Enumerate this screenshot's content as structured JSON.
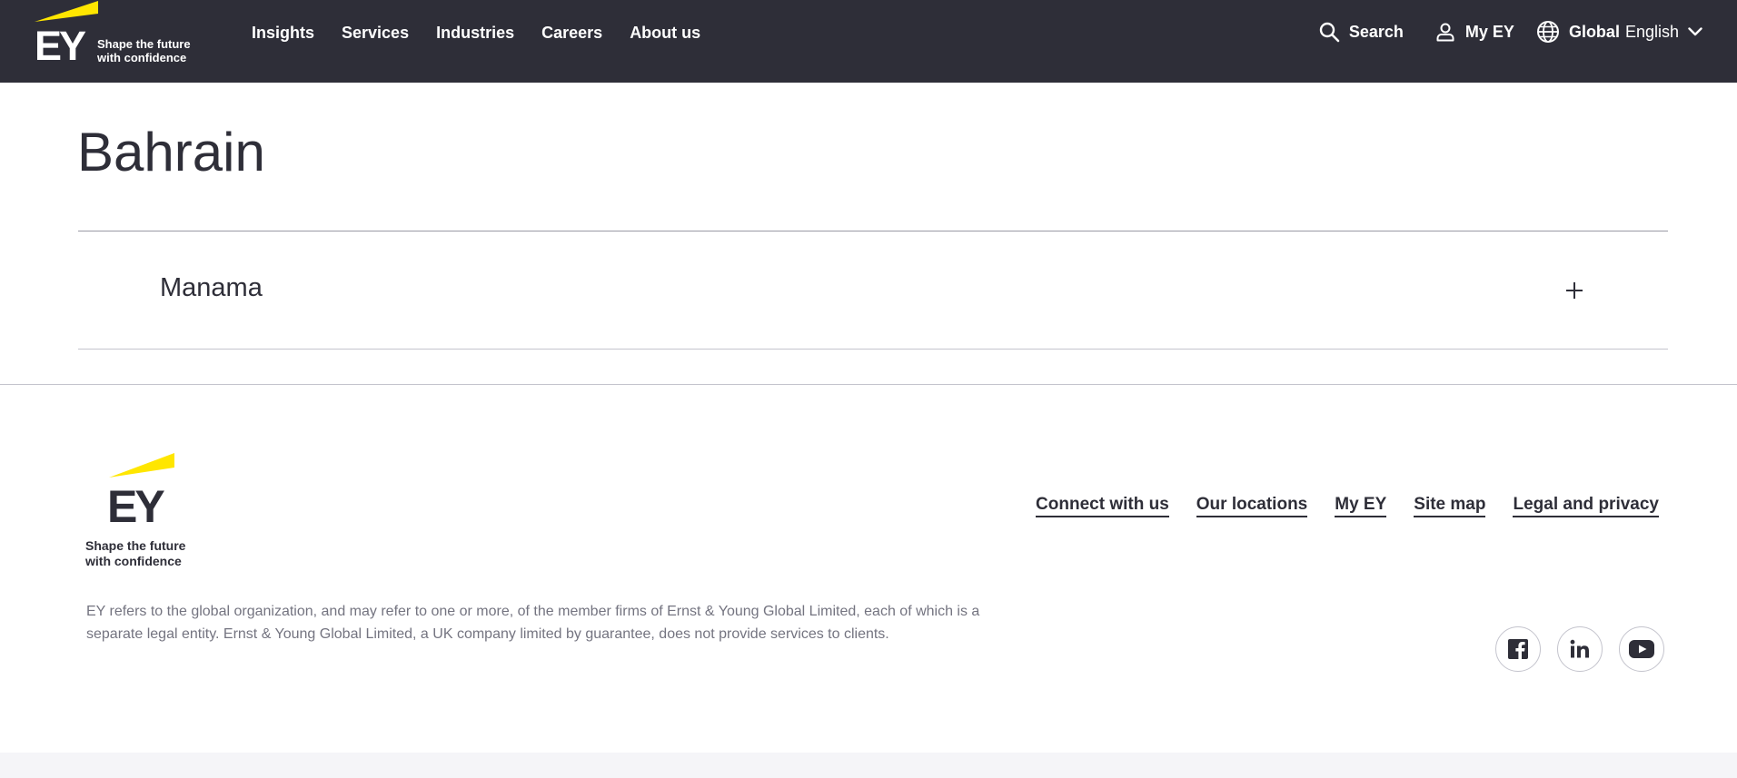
{
  "brand": {
    "logo_text": "EY",
    "tagline_line1": "Shape the future",
    "tagline_line2": "with confidence",
    "accent_color": "#ffe600",
    "header_bg": "#2e2e38"
  },
  "nav": {
    "items": [
      "Insights",
      "Services",
      "Industries",
      "Careers",
      "About us"
    ]
  },
  "utility": {
    "search_label": "Search",
    "myey_label": "My EY",
    "region_label": "Global",
    "language_label": "English"
  },
  "main": {
    "title": "Bahrain",
    "accordion": [
      {
        "label": "Manama",
        "icon": "plus-icon"
      }
    ]
  },
  "footer": {
    "logo_text": "EY",
    "tagline_line1": "Shape the future",
    "tagline_line2": "with confidence",
    "links": [
      "Connect with us",
      "Our locations",
      "My EY",
      "Site map",
      "Legal and privacy"
    ],
    "disclaimer": "EY refers to the global organization, and may refer to one or more, of the member firms of Ernst & Young Global Limited, each of which is a separate legal entity. Ernst & Young Global Limited, a UK company limited by guarantee, does not provide services to clients.",
    "social": [
      "facebook-icon",
      "linkedin-icon",
      "youtube-icon"
    ]
  }
}
